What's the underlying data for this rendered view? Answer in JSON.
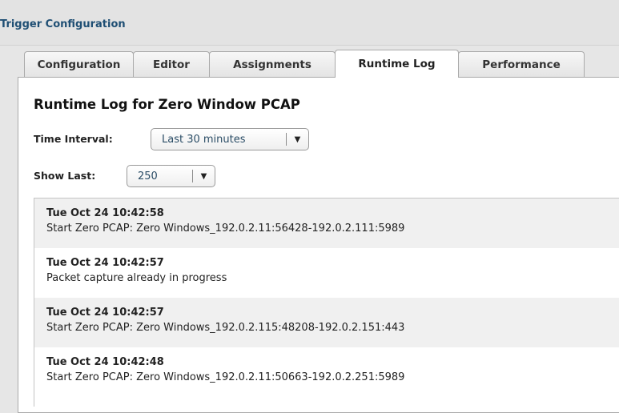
{
  "window": {
    "title": "Trigger Configuration"
  },
  "tabs": [
    {
      "label": "Configuration"
    },
    {
      "label": "Editor"
    },
    {
      "label": "Assignments"
    },
    {
      "label": "Runtime Log",
      "active": true
    },
    {
      "label": "Performance"
    }
  ],
  "page": {
    "heading": "Runtime Log for Zero Window PCAP"
  },
  "filters": {
    "time_interval": {
      "label": "Time Interval:",
      "value": "Last 30 minutes"
    },
    "show_last": {
      "label": "Show Last:",
      "value": "250"
    }
  },
  "log": {
    "entries": [
      {
        "timestamp": "Tue Oct 24 10:42:58",
        "message": "Start Zero PCAP: Zero Windows_192.0.2.11:56428-192.0.2.111:5989"
      },
      {
        "timestamp": "Tue Oct 24 10:42:57",
        "message": "Packet capture already in progress"
      },
      {
        "timestamp": "Tue Oct 24 10:42:57",
        "message": "Start Zero PCAP: Zero Windows_192.0.2.115:48208-192.0.2.151:443"
      },
      {
        "timestamp": "Tue Oct 24 10:42:48",
        "message": "Start Zero PCAP: Zero Windows_192.0.2.11:50663-192.0.2.251:5989"
      }
    ]
  },
  "colors": {
    "title_text": "#1f4f74",
    "select_text": "#2b4d66",
    "row_shade": "#f0f0f0",
    "chrome_background": "#e6e6e6"
  },
  "icons": {
    "dropdown": "chevron-down-icon"
  }
}
